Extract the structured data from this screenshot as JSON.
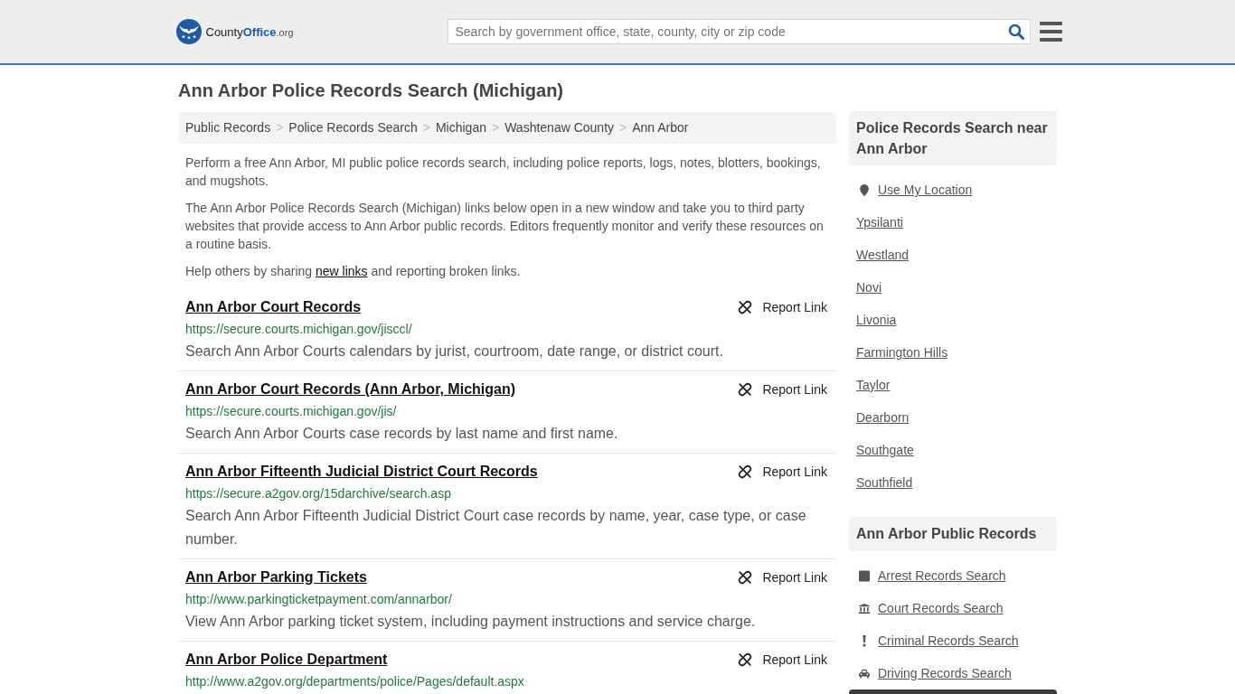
{
  "header": {
    "logo": {
      "name": "County",
      "accent": "Office",
      "suffix": ".org"
    },
    "search": {
      "placeholder": "Search by government office, state, county, city or zip code"
    }
  },
  "page_title": "Ann Arbor Police Records Search (Michigan)",
  "breadcrumb": {
    "separator": ">",
    "items": [
      "Public Records",
      "Police Records Search",
      "Michigan",
      "Washtenaw County",
      "Ann Arbor"
    ]
  },
  "intro": [
    "Perform a free Ann Arbor, MI public police records search, including police reports, logs, notes, blotters, bookings, and mugshots.",
    "The Ann Arbor Police Records Search (Michigan) links below open in a new window and take you to third party websites that provide access to Ann Arbor public records. Editors frequently monitor and verify these resources on a routine basis."
  ],
  "share_note": {
    "before": "Help others by sharing ",
    "link": "new links",
    "after": " and reporting broken links."
  },
  "results": [
    {
      "title": "Ann Arbor Court Records",
      "url": "https://secure.courts.michigan.gov/jisccl/",
      "description": "Search Ann Arbor Courts calendars by jurist, courtroom, date range, or district court.",
      "report": "Report Link"
    },
    {
      "title": "Ann Arbor Court Records (Ann Arbor, Michigan)",
      "url": "https://secure.courts.michigan.gov/jis/",
      "description": "Search Ann Arbor Courts case records by last name and first name.",
      "report": "Report Link"
    },
    {
      "title": "Ann Arbor Fifteenth Judicial District Court Records",
      "url": "https://secure.a2gov.org/15darchive/search.asp",
      "description": "Search Ann Arbor Fifteenth Judicial District Court case records by name, year, case type, or case number.",
      "report": "Report Link"
    },
    {
      "title": "Ann Arbor Parking Tickets",
      "url": "http://www.parkingticketpayment.com/annarbor/",
      "description": "View Ann Arbor parking ticket system, including payment instructions and service charge.",
      "report": "Report Link"
    },
    {
      "title": "Ann Arbor Police Department",
      "url": "http://www.a2gov.org/departments/police/Pages/default.aspx",
      "report": "Report Link"
    }
  ],
  "sidebar": {
    "nearby": {
      "title": "Police Records Search near Ann Arbor",
      "items": [
        {
          "label": "Use My Location",
          "kind": "location"
        },
        {
          "label": "Ypsilanti",
          "kind": "city"
        },
        {
          "label": "Westland",
          "kind": "city"
        },
        {
          "label": "Novi",
          "kind": "city"
        },
        {
          "label": "Livonia",
          "kind": "city"
        },
        {
          "label": "Farmington Hills",
          "kind": "city"
        },
        {
          "label": "Taylor",
          "kind": "city"
        },
        {
          "label": "Dearborn",
          "kind": "city"
        },
        {
          "label": "Southgate",
          "kind": "city"
        },
        {
          "label": "Southfield",
          "kind": "city"
        }
      ]
    },
    "public_records": {
      "title": "Ann Arbor Public Records",
      "items": [
        {
          "label": "Arrest Records Search",
          "kind": "arrest"
        },
        {
          "label": "Court Records Search",
          "kind": "court"
        },
        {
          "label": "Criminal Records Search",
          "kind": "criminal"
        },
        {
          "label": "Driving Records Search",
          "kind": "driving"
        }
      ]
    }
  }
}
